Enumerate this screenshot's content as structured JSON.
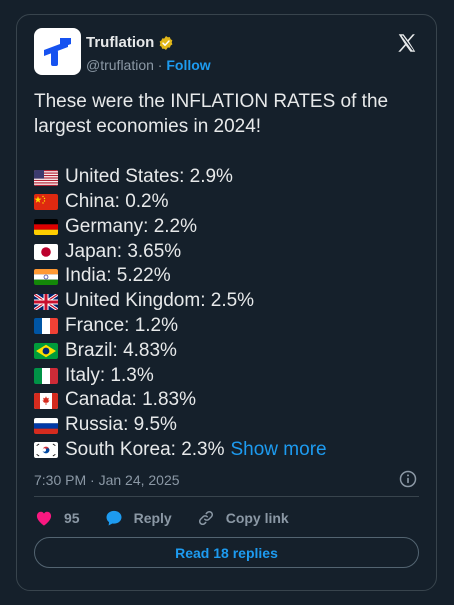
{
  "header": {
    "name": "Truflation",
    "handle": "@truflation",
    "separator": " · ",
    "follow_label": "Follow"
  },
  "tweet": {
    "intro": "These were the INFLATION RATES of the largest economies in 2024!",
    "items": [
      {
        "flag": "us-flag-icon",
        "text": "United States: 2.9%"
      },
      {
        "flag": "china-flag-icon",
        "text": "China: 0.2%"
      },
      {
        "flag": "germany-flag-icon",
        "text": "Germany: 2.2%"
      },
      {
        "flag": "japan-flag-icon",
        "text": "Japan: 3.65%"
      },
      {
        "flag": "india-flag-icon",
        "text": "India: 5.22%"
      },
      {
        "flag": "uk-flag-icon",
        "text": "United Kingdom: 2.5%"
      },
      {
        "flag": "france-flag-icon",
        "text": "France: 1.2%"
      },
      {
        "flag": "brazil-flag-icon",
        "text": "Brazil: 4.83%"
      },
      {
        "flag": "italy-flag-icon",
        "text": "Italy: 1.3%"
      },
      {
        "flag": "canada-flag-icon",
        "text": "Canada: 1.83%"
      },
      {
        "flag": "russia-flag-icon",
        "text": "Russia: 9.5%"
      },
      {
        "flag": "south-korea-flag-icon",
        "text": "South Korea: 2.3%"
      }
    ],
    "show_more": "Show more",
    "timestamp": "7:30 PM · Jan 24, 2025"
  },
  "actions": {
    "like_count": "95",
    "reply_label": "Reply",
    "copy_link_label": "Copy link"
  },
  "replies_button": "Read 18 replies",
  "colors": {
    "background": "#15202b",
    "accent": "#1d9bf0",
    "like": "#f91880",
    "muted": "#8b98a5",
    "verified_gold": "#e2b719"
  }
}
